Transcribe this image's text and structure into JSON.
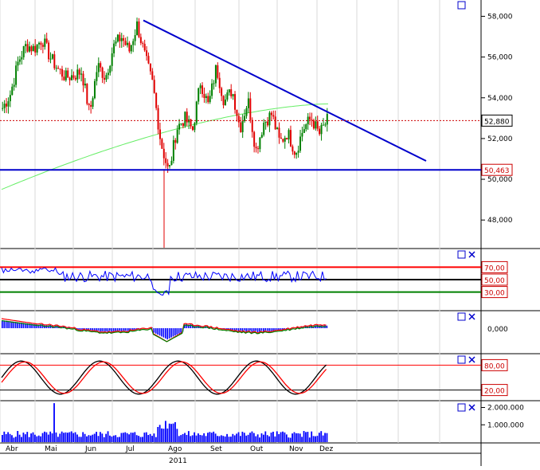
{
  "chart_data": {
    "type": "candlestick",
    "year_label": "2011",
    "months": [
      "Abr",
      "Mai",
      "Jun",
      "Jul",
      "Ago",
      "Set",
      "Out",
      "Nov",
      "Dez"
    ],
    "price_panel": {
      "y_ticks": [
        "48,000",
        "50,000",
        "52,000",
        "54,000",
        "56,000",
        "58,000"
      ],
      "ylim": [
        46600,
        58800
      ],
      "last_price_label": "52,880",
      "last_price": 52880,
      "support_label": "50,463",
      "support": 50463,
      "trendline": {
        "start": {
          "date": "Jul",
          "value": 57800
        },
        "end": {
          "date": "Dez",
          "value": 50900
        }
      },
      "ma_start": 49500,
      "ma_end": 53700,
      "closes": [
        53500,
        54200,
        55800,
        56600,
        56400,
        56900,
        56000,
        55400,
        55000,
        55100,
        55300,
        53200,
        55600,
        55000,
        56500,
        57000,
        56300,
        57600,
        56000,
        54600,
        51800,
        50300,
        52500,
        53000,
        52400,
        54800,
        53600,
        55500,
        53800,
        54400,
        52500,
        53900,
        51400,
        52800,
        53200,
        51800,
        52300,
        51300,
        52500,
        53000,
        52200,
        52880
      ]
    },
    "panel_rsi": {
      "labels": [
        "70,00",
        "50,00",
        "30,00"
      ],
      "values": [
        70,
        50,
        30
      ]
    },
    "panel_macd": {
      "labels": [
        "0,000"
      ]
    },
    "panel_stoch": {
      "labels": [
        "80,00",
        "20,00"
      ],
      "values": [
        80,
        20
      ]
    },
    "panel_volume": {
      "labels": [
        "2.000.000",
        "1.000.000"
      ],
      "values": [
        2000000,
        1000000
      ]
    },
    "colors": {
      "up": "#008000",
      "down": "#e00000",
      "trend": "#0000cc",
      "support": "#0000cc",
      "ma": "#66ee66",
      "rsi": "#0000ff",
      "macd_hist": "#0000ff",
      "signal_red": "#ff0000",
      "signal_green": "#008000",
      "stoch_k": "#000000",
      "stoch_d": "#ff0000",
      "volume": "#0000ff",
      "overbought": "#ff0000",
      "oversold": "#008000"
    }
  }
}
